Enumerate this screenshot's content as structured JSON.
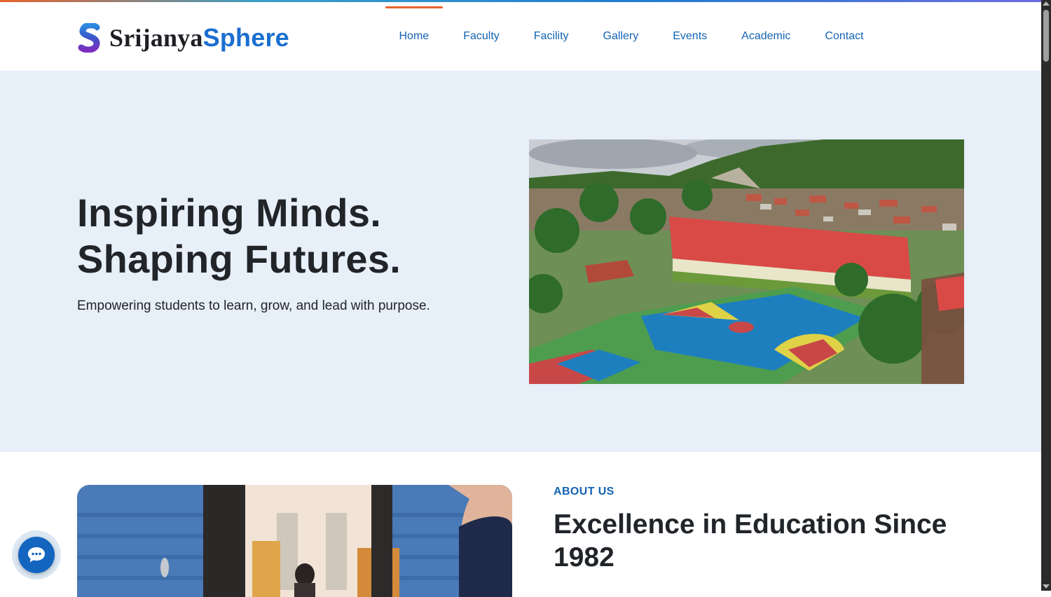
{
  "brand": {
    "name_part1": "Srijanya",
    "name_part2": "Sphere",
    "logo_icon": "s-logo-icon"
  },
  "nav": {
    "items": [
      {
        "label": "Home",
        "active": true
      },
      {
        "label": "Faculty"
      },
      {
        "label": "Facility"
      },
      {
        "label": "Gallery"
      },
      {
        "label": "Events"
      },
      {
        "label": "Academic"
      },
      {
        "label": "Contact"
      }
    ]
  },
  "hero": {
    "title_line1": "Inspiring Minds.",
    "title_line2": "Shaping Futures.",
    "subtitle": "Empowering students to learn, grow, and lead with purpose.",
    "image_icon": "campus-aerial-photo"
  },
  "about": {
    "eyebrow": "ABOUT US",
    "title": "Excellence in Education Since 1982",
    "image_icon": "students-photo"
  },
  "chat": {
    "icon": "chat-bubble-icon"
  },
  "colors": {
    "brand_blue": "#1b6fd0",
    "nav_blue": "#1363b3",
    "accent_orange": "#e8632c",
    "hero_bg": "#e7eff9",
    "text_dark": "#212529"
  }
}
